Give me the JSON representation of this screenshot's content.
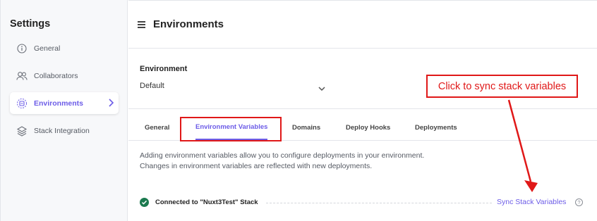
{
  "sidebar": {
    "title": "Settings",
    "items": [
      {
        "label": "General",
        "icon": "info-circle-icon"
      },
      {
        "label": "Collaborators",
        "icon": "users-icon"
      },
      {
        "label": "Environments",
        "icon": "environments-icon",
        "active": true
      },
      {
        "label": "Stack Integration",
        "icon": "layers-icon"
      }
    ]
  },
  "header": {
    "title": "Environments"
  },
  "environment": {
    "label": "Environment",
    "value": "Default"
  },
  "annotation": {
    "text": "Click to sync stack variables",
    "color": "#e01818"
  },
  "tabs": [
    {
      "label": "General"
    },
    {
      "label": "Environment Variables",
      "active": true
    },
    {
      "label": "Domains"
    },
    {
      "label": "Deploy Hooks"
    },
    {
      "label": "Deployments"
    }
  ],
  "description": {
    "line1": "Adding environment variables allow you to configure deployments in your environment.",
    "line2": "Changes in environment variables are reflected with new deployments."
  },
  "connection": {
    "text": "Connected to \"Nuxt3Test\" Stack",
    "sync_label": "Sync Stack Variables",
    "help_symbol": "?"
  },
  "colors": {
    "accent": "#6c5ce7",
    "success": "#1b7a4f",
    "annotation": "#e01818"
  }
}
